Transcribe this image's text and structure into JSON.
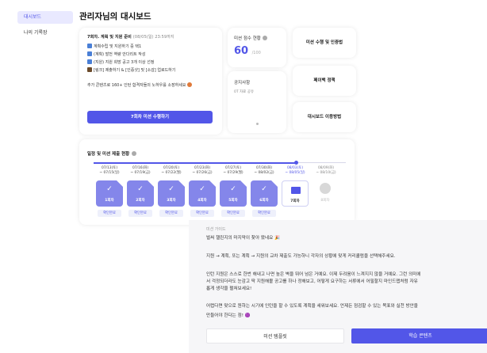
{
  "sidebar": {
    "items": [
      {
        "label": "대시보드"
      },
      {
        "label": "나의 기록장"
      }
    ]
  },
  "page_title": "관리자님의 대시보드",
  "mission": {
    "title": "7회차. 계획 및 지원 준비",
    "date": "(08/05(일) 23:59까지",
    "tasks": [
      {
        "text": "계획수립 및 지원하기 중 택1",
        "color": "#4a7fd6"
      },
      {
        "text": "(계획) 발전 역량 안다리트 작성",
        "color": "#4a7fd6"
      },
      {
        "text": "(지원) 지원 희망 공고 3개 이상 선정",
        "color": "#4a7fd6"
      },
      {
        "text": "[링크] 제출하기 & [인증샷] 및 [소감] 업로드하기",
        "color": "#6b4a2a"
      }
    ],
    "extra_note": "추가 콘텐츠로 160+ 인턴 합격자들의 노하우를 소장하세요",
    "cta": "7회차 미션 수행하기"
  },
  "score": {
    "label": "미션 점수 현황",
    "value": "60",
    "max": "/100"
  },
  "notice": {
    "title": "공지사항",
    "subtitle": "0T 자료 공유"
  },
  "quick_links": [
    {
      "label": "미션 수행 및 인증법"
    },
    {
      "label": "페이백 정책"
    },
    {
      "label": "대시보드 이용방법"
    }
  ],
  "timeline": {
    "title": "일정 및 미션 제출 현황",
    "dates": [
      {
        "line1": "07/13(토)",
        "line2": "~ 07/15(일)"
      },
      {
        "line1": "07/16(화)",
        "line2": "~ 07/19(금)"
      },
      {
        "line1": "07/20(토)",
        "line2": "~ 07/22(월)"
      },
      {
        "line1": "07/23(화)",
        "line2": "~ 07/26(금)"
      },
      {
        "line1": "07/27(토)",
        "line2": "~ 07/29(월)"
      },
      {
        "line1": "07/30(화)",
        "line2": "~ 08/02(금)"
      },
      {
        "line1": "08/03(토)",
        "line2": "~ 08/05(일)"
      },
      {
        "line1": "08/09(화)",
        "line2": "~ 08/10(금)"
      }
    ],
    "rounds": [
      {
        "label": "1회차",
        "status": "확인완료"
      },
      {
        "label": "2회차",
        "status": "확인완료"
      },
      {
        "label": "3회차",
        "status": "확인완료"
      },
      {
        "label": "4회차",
        "status": "확인완료"
      },
      {
        "label": "5회차",
        "status": "확인완료"
      },
      {
        "label": "6회차",
        "status": "확인완료"
      },
      {
        "label": "7회차"
      },
      {
        "label": "8회차"
      }
    ]
  },
  "guide": {
    "heading": "미션 가이드",
    "paragraphs": [
      "벌써 챌린지의 마지막이 찾아 왔네요 🎉",
      "지원 → 계획, 또는 계획 → 지원의 교차 제출도 가능하니 각자의 상황에 맞게 커리큘럼을 선택해주세요.",
      "인턴 지원은 스스로 한번 해내고 나면 높은 벽을 뛰어 넘은 거예요. 이제 두려움이 느껴지지 않을 거예요. 그런 의미에",
      "서 걱정되더라도 눈감고 딱 지원해볼 공고를 하나 정해보고, 어떻게 요구하는 서류에서 어필할지 마인드맵처럼 자유",
      "롭게 생각을 펼쳐보세요!",
      "어렵다면 맞으로 원하는 시기에 인턴을 할 수 있도록 계획을 세워보세요. 언제든 점검할 수 있는 목표와 실천 방안을",
      "만들어야 한다는 점! 🟣"
    ],
    "secondary_button": "미션 템플릿",
    "primary_button": "학습 콘텐츠"
  }
}
